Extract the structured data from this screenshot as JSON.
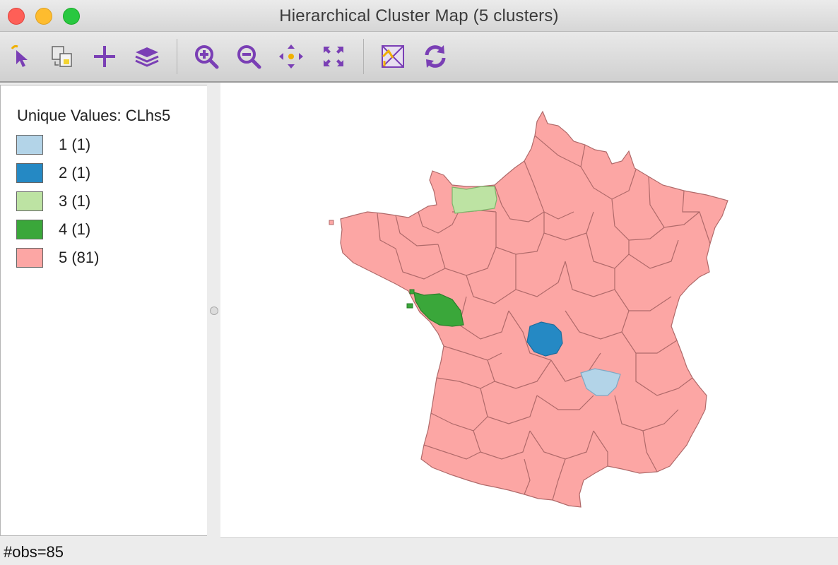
{
  "window": {
    "title": "Hierarchical Cluster Map (5 clusters)"
  },
  "toolbar": {
    "buttons": [
      {
        "name": "select-tool",
        "icon": "select-arrow-icon"
      },
      {
        "name": "copy-image",
        "icon": "copy-image-icon"
      },
      {
        "name": "add-layer",
        "icon": "plus-icon"
      },
      {
        "name": "layers",
        "icon": "layers-icon"
      },
      {
        "name": "zoom-in",
        "icon": "zoom-in-icon"
      },
      {
        "name": "zoom-out",
        "icon": "zoom-out-icon"
      },
      {
        "name": "pan",
        "icon": "pan-icon"
      },
      {
        "name": "full-extent",
        "icon": "full-extent-icon"
      },
      {
        "name": "basemap",
        "icon": "basemap-icon"
      },
      {
        "name": "refresh",
        "icon": "refresh-icon"
      }
    ],
    "icon_color": "#7a3fb5"
  },
  "legend": {
    "title": "Unique Values: CLhs5",
    "items": [
      {
        "label": "1 (1)",
        "color": "#b3d4e8"
      },
      {
        "label": "2 (1)",
        "color": "#2589c4"
      },
      {
        "label": "3 (1)",
        "color": "#bde3a3"
      },
      {
        "label": "4 (1)",
        "color": "#3aa73a"
      },
      {
        "label": "5 (81)",
        "color": "#fca6a4"
      }
    ]
  },
  "map": {
    "border_color": "#b06a6a",
    "regions": [
      {
        "cluster": 5,
        "name": "rest-of-france"
      },
      {
        "cluster": 3,
        "name": "normandy-department"
      },
      {
        "cluster": 4,
        "name": "vendee-department"
      },
      {
        "cluster": 2,
        "name": "creuse-department"
      },
      {
        "cluster": 1,
        "name": "cantal-department"
      }
    ]
  },
  "status": {
    "text": "#obs=85"
  }
}
